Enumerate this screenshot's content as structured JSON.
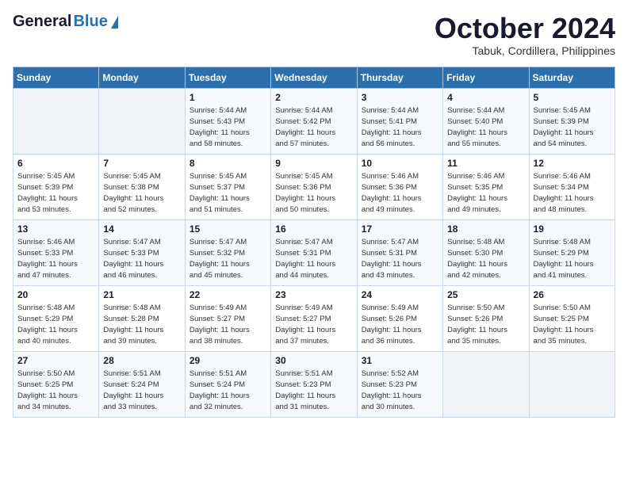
{
  "header": {
    "logo_general": "General",
    "logo_blue": "Blue",
    "month_title": "October 2024",
    "location": "Tabuk, Cordillera, Philippines"
  },
  "days_of_week": [
    "Sunday",
    "Monday",
    "Tuesday",
    "Wednesday",
    "Thursday",
    "Friday",
    "Saturday"
  ],
  "weeks": [
    [
      {
        "day": "",
        "info": ""
      },
      {
        "day": "",
        "info": ""
      },
      {
        "day": "1",
        "info": "Sunrise: 5:44 AM\nSunset: 5:43 PM\nDaylight: 11 hours\nand 58 minutes."
      },
      {
        "day": "2",
        "info": "Sunrise: 5:44 AM\nSunset: 5:42 PM\nDaylight: 11 hours\nand 57 minutes."
      },
      {
        "day": "3",
        "info": "Sunrise: 5:44 AM\nSunset: 5:41 PM\nDaylight: 11 hours\nand 56 minutes."
      },
      {
        "day": "4",
        "info": "Sunrise: 5:44 AM\nSunset: 5:40 PM\nDaylight: 11 hours\nand 55 minutes."
      },
      {
        "day": "5",
        "info": "Sunrise: 5:45 AM\nSunset: 5:39 PM\nDaylight: 11 hours\nand 54 minutes."
      }
    ],
    [
      {
        "day": "6",
        "info": "Sunrise: 5:45 AM\nSunset: 5:39 PM\nDaylight: 11 hours\nand 53 minutes."
      },
      {
        "day": "7",
        "info": "Sunrise: 5:45 AM\nSunset: 5:38 PM\nDaylight: 11 hours\nand 52 minutes."
      },
      {
        "day": "8",
        "info": "Sunrise: 5:45 AM\nSunset: 5:37 PM\nDaylight: 11 hours\nand 51 minutes."
      },
      {
        "day": "9",
        "info": "Sunrise: 5:45 AM\nSunset: 5:36 PM\nDaylight: 11 hours\nand 50 minutes."
      },
      {
        "day": "10",
        "info": "Sunrise: 5:46 AM\nSunset: 5:36 PM\nDaylight: 11 hours\nand 49 minutes."
      },
      {
        "day": "11",
        "info": "Sunrise: 5:46 AM\nSunset: 5:35 PM\nDaylight: 11 hours\nand 49 minutes."
      },
      {
        "day": "12",
        "info": "Sunrise: 5:46 AM\nSunset: 5:34 PM\nDaylight: 11 hours\nand 48 minutes."
      }
    ],
    [
      {
        "day": "13",
        "info": "Sunrise: 5:46 AM\nSunset: 5:33 PM\nDaylight: 11 hours\nand 47 minutes."
      },
      {
        "day": "14",
        "info": "Sunrise: 5:47 AM\nSunset: 5:33 PM\nDaylight: 11 hours\nand 46 minutes."
      },
      {
        "day": "15",
        "info": "Sunrise: 5:47 AM\nSunset: 5:32 PM\nDaylight: 11 hours\nand 45 minutes."
      },
      {
        "day": "16",
        "info": "Sunrise: 5:47 AM\nSunset: 5:31 PM\nDaylight: 11 hours\nand 44 minutes."
      },
      {
        "day": "17",
        "info": "Sunrise: 5:47 AM\nSunset: 5:31 PM\nDaylight: 11 hours\nand 43 minutes."
      },
      {
        "day": "18",
        "info": "Sunrise: 5:48 AM\nSunset: 5:30 PM\nDaylight: 11 hours\nand 42 minutes."
      },
      {
        "day": "19",
        "info": "Sunrise: 5:48 AM\nSunset: 5:29 PM\nDaylight: 11 hours\nand 41 minutes."
      }
    ],
    [
      {
        "day": "20",
        "info": "Sunrise: 5:48 AM\nSunset: 5:29 PM\nDaylight: 11 hours\nand 40 minutes."
      },
      {
        "day": "21",
        "info": "Sunrise: 5:48 AM\nSunset: 5:28 PM\nDaylight: 11 hours\nand 39 minutes."
      },
      {
        "day": "22",
        "info": "Sunrise: 5:49 AM\nSunset: 5:27 PM\nDaylight: 11 hours\nand 38 minutes."
      },
      {
        "day": "23",
        "info": "Sunrise: 5:49 AM\nSunset: 5:27 PM\nDaylight: 11 hours\nand 37 minutes."
      },
      {
        "day": "24",
        "info": "Sunrise: 5:49 AM\nSunset: 5:26 PM\nDaylight: 11 hours\nand 36 minutes."
      },
      {
        "day": "25",
        "info": "Sunrise: 5:50 AM\nSunset: 5:26 PM\nDaylight: 11 hours\nand 35 minutes."
      },
      {
        "day": "26",
        "info": "Sunrise: 5:50 AM\nSunset: 5:25 PM\nDaylight: 11 hours\nand 35 minutes."
      }
    ],
    [
      {
        "day": "27",
        "info": "Sunrise: 5:50 AM\nSunset: 5:25 PM\nDaylight: 11 hours\nand 34 minutes."
      },
      {
        "day": "28",
        "info": "Sunrise: 5:51 AM\nSunset: 5:24 PM\nDaylight: 11 hours\nand 33 minutes."
      },
      {
        "day": "29",
        "info": "Sunrise: 5:51 AM\nSunset: 5:24 PM\nDaylight: 11 hours\nand 32 minutes."
      },
      {
        "day": "30",
        "info": "Sunrise: 5:51 AM\nSunset: 5:23 PM\nDaylight: 11 hours\nand 31 minutes."
      },
      {
        "day": "31",
        "info": "Sunrise: 5:52 AM\nSunset: 5:23 PM\nDaylight: 11 hours\nand 30 minutes."
      },
      {
        "day": "",
        "info": ""
      },
      {
        "day": "",
        "info": ""
      }
    ]
  ]
}
